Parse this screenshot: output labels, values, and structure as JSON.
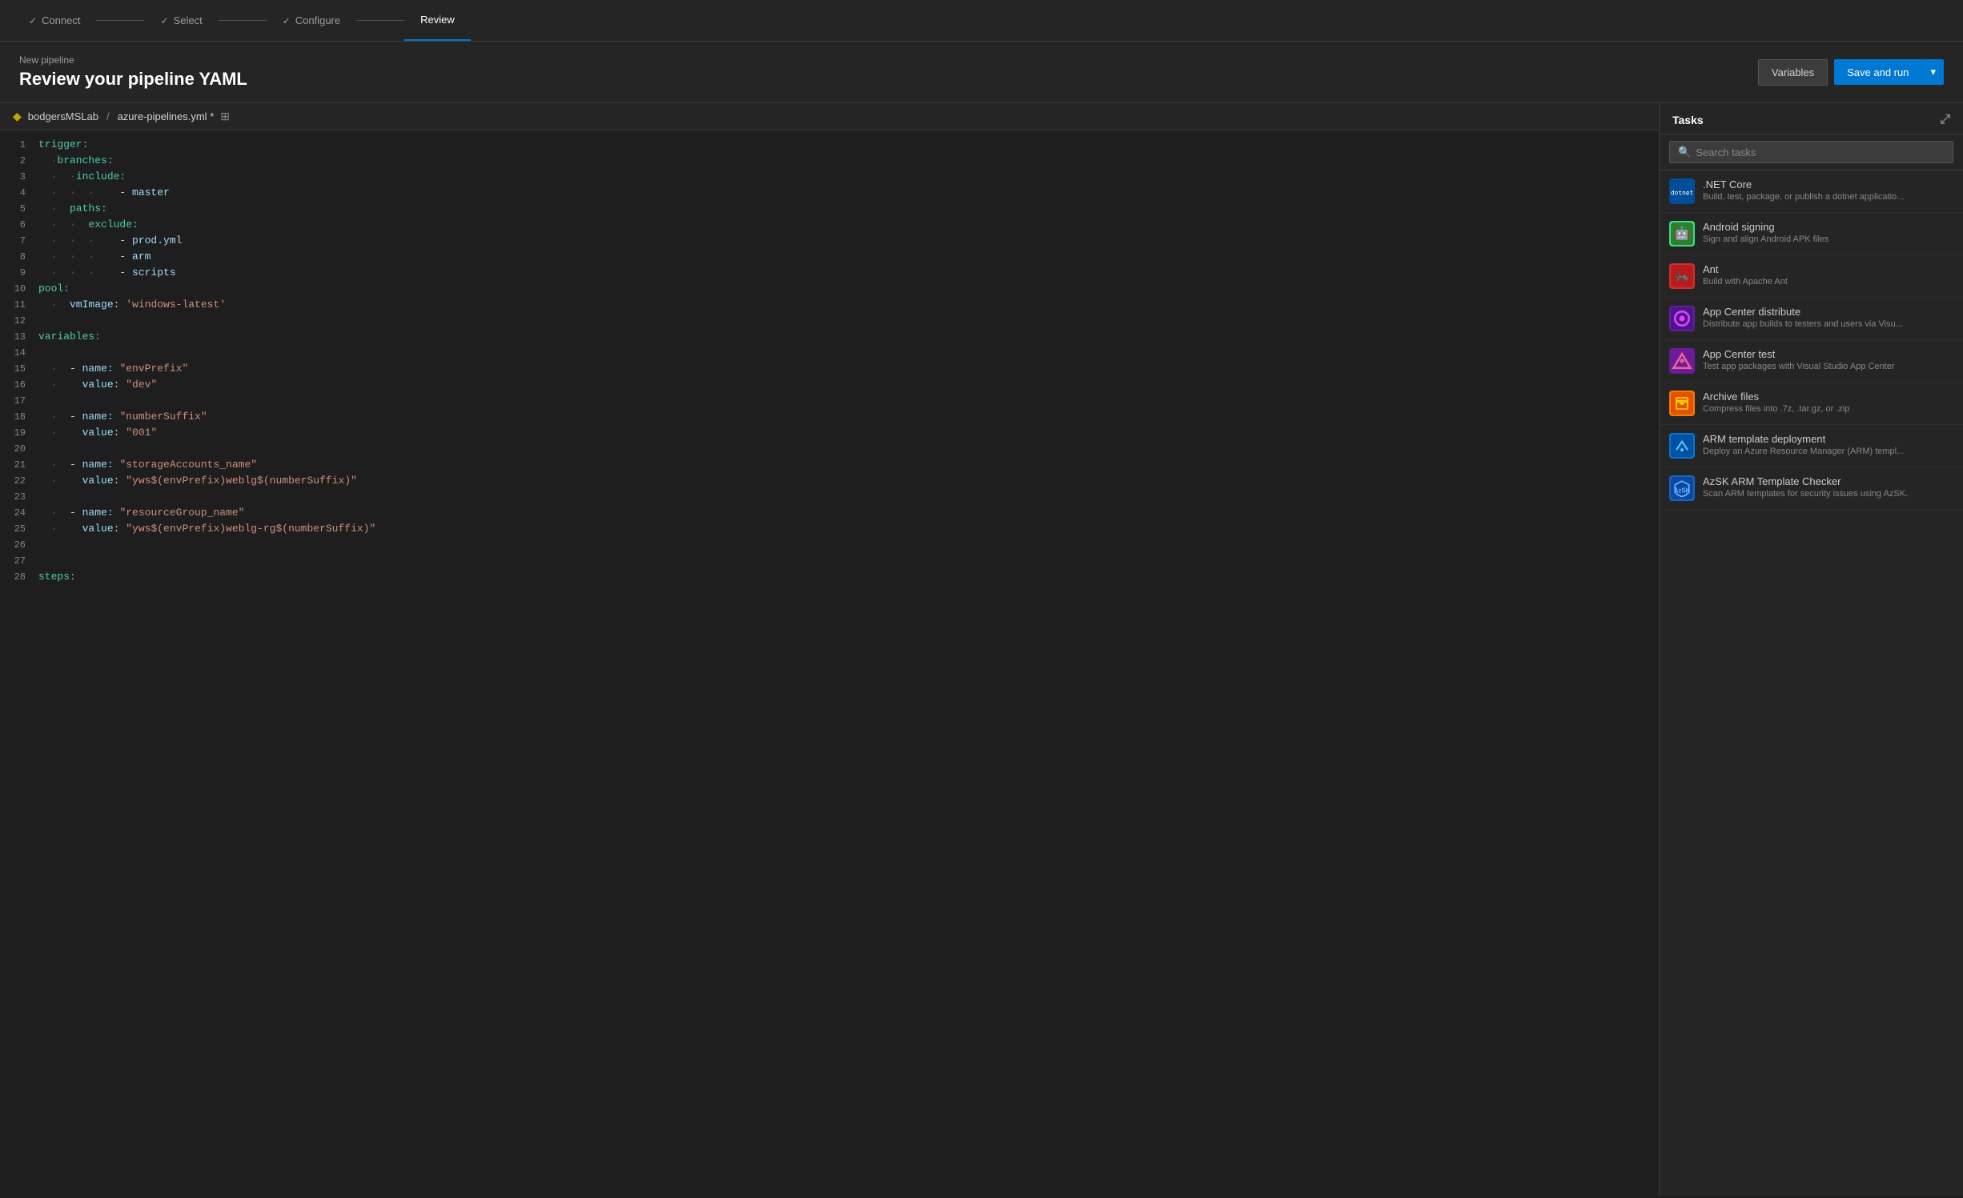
{
  "nav": {
    "steps": [
      {
        "id": "connect",
        "label": "Connect",
        "completed": true
      },
      {
        "id": "select",
        "label": "Select",
        "completed": true
      },
      {
        "id": "configure",
        "label": "Configure",
        "completed": true
      },
      {
        "id": "review",
        "label": "Review",
        "active": true
      }
    ]
  },
  "header": {
    "subtitle": "New pipeline",
    "title": "Review your pipeline YAML",
    "variables_btn": "Variables",
    "save_run_btn": "Save and run"
  },
  "editor": {
    "repo": "bodgersMSLab",
    "separator": "/",
    "filename": "azure-pipelines.yml",
    "modified_marker": "*",
    "lines": [
      {
        "num": 1,
        "content": "trigger:",
        "tokens": [
          {
            "text": "trigger:",
            "class": "kw-green"
          }
        ]
      },
      {
        "num": 2,
        "indent": 1,
        "tokens": [
          {
            "text": "  "
          },
          {
            "text": "branches:",
            "class": "kw-green"
          }
        ]
      },
      {
        "num": 3,
        "indent": 2,
        "tokens": [
          {
            "text": "    "
          },
          {
            "text": "include:",
            "class": "kw-green"
          }
        ]
      },
      {
        "num": 4,
        "indent": 3,
        "tokens": [
          {
            "text": "      "
          },
          {
            "text": "- ",
            "class": "kw-white"
          },
          {
            "text": "master",
            "class": "kw-light"
          }
        ]
      },
      {
        "num": 5,
        "indent": 1,
        "tokens": [
          {
            "text": "  "
          },
          {
            "text": "paths:",
            "class": "kw-green"
          }
        ]
      },
      {
        "num": 6,
        "indent": 2,
        "tokens": [
          {
            "text": "    "
          },
          {
            "text": "exclude:",
            "class": "kw-green"
          }
        ]
      },
      {
        "num": 7,
        "indent": 3,
        "tokens": [
          {
            "text": "      "
          },
          {
            "text": "- ",
            "class": "kw-white"
          },
          {
            "text": "prod.yml",
            "class": "kw-light"
          }
        ]
      },
      {
        "num": 8,
        "indent": 3,
        "tokens": [
          {
            "text": "      "
          },
          {
            "text": "- ",
            "class": "kw-white"
          },
          {
            "text": "arm",
            "class": "kw-light"
          }
        ]
      },
      {
        "num": 9,
        "indent": 3,
        "tokens": [
          {
            "text": "      "
          },
          {
            "text": "- ",
            "class": "kw-white"
          },
          {
            "text": "scripts",
            "class": "kw-light"
          }
        ]
      },
      {
        "num": 10,
        "tokens": [
          {
            "text": "pool:",
            "class": "kw-green"
          }
        ]
      },
      {
        "num": 11,
        "indent": 1,
        "tokens": [
          {
            "text": "  "
          },
          {
            "text": "vmImage: ",
            "class": "kw-light"
          },
          {
            "text": "'windows-latest'",
            "class": "kw-orange"
          }
        ]
      },
      {
        "num": 12,
        "tokens": []
      },
      {
        "num": 13,
        "tokens": [
          {
            "text": "variables:",
            "class": "kw-green"
          }
        ]
      },
      {
        "num": 14,
        "tokens": []
      },
      {
        "num": 15,
        "indent": 1,
        "tokens": [
          {
            "text": "  "
          },
          {
            "text": "- ",
            "class": "kw-white"
          },
          {
            "text": "name: ",
            "class": "kw-light"
          },
          {
            "text": "\"envPrefix\"",
            "class": "kw-orange"
          }
        ]
      },
      {
        "num": 16,
        "indent": 1,
        "tokens": [
          {
            "text": "    "
          },
          {
            "text": "value: ",
            "class": "kw-light"
          },
          {
            "text": "\"dev\"",
            "class": "kw-orange"
          }
        ]
      },
      {
        "num": 17,
        "tokens": []
      },
      {
        "num": 18,
        "indent": 1,
        "tokens": [
          {
            "text": "  "
          },
          {
            "text": "- ",
            "class": "kw-white"
          },
          {
            "text": "name: ",
            "class": "kw-light"
          },
          {
            "text": "\"numberSuffix\"",
            "class": "kw-orange"
          }
        ]
      },
      {
        "num": 19,
        "indent": 1,
        "tokens": [
          {
            "text": "    "
          },
          {
            "text": "value: ",
            "class": "kw-light"
          },
          {
            "text": "\"001\"",
            "class": "kw-orange"
          }
        ]
      },
      {
        "num": 20,
        "tokens": []
      },
      {
        "num": 21,
        "indent": 1,
        "tokens": [
          {
            "text": "  "
          },
          {
            "text": "- ",
            "class": "kw-white"
          },
          {
            "text": "name: ",
            "class": "kw-light"
          },
          {
            "text": "\"storageAccounts_name\"",
            "class": "kw-orange"
          }
        ]
      },
      {
        "num": 22,
        "indent": 1,
        "tokens": [
          {
            "text": "    "
          },
          {
            "text": "value: ",
            "class": "kw-light"
          },
          {
            "text": "\"yws$(envPrefix)weblg$(numberSuffix)\"",
            "class": "kw-orange"
          }
        ]
      },
      {
        "num": 23,
        "tokens": []
      },
      {
        "num": 24,
        "indent": 1,
        "tokens": [
          {
            "text": "  "
          },
          {
            "text": "- ",
            "class": "kw-white"
          },
          {
            "text": "name: ",
            "class": "kw-light"
          },
          {
            "text": "\"resourceGroup_name\"",
            "class": "kw-orange"
          }
        ]
      },
      {
        "num": 25,
        "indent": 1,
        "tokens": [
          {
            "text": "    "
          },
          {
            "text": "value: ",
            "class": "kw-light"
          },
          {
            "text": "\"yws$(envPrefix)weblg-rg$(numberSuffix)\"",
            "class": "kw-orange"
          }
        ]
      },
      {
        "num": 26,
        "tokens": []
      },
      {
        "num": 27,
        "tokens": []
      },
      {
        "num": 28,
        "tokens": [
          {
            "text": "steps:",
            "class": "kw-green"
          }
        ]
      }
    ]
  },
  "tasks": {
    "title": "Tasks",
    "search_placeholder": "Search tasks",
    "items": [
      {
        "id": "dotnet-core",
        "name": ".NET Core",
        "description": "Build, test, package, or publish a dotnet applicatio...",
        "icon_type": "dotnet",
        "icon_text": "dotnet"
      },
      {
        "id": "android-signing",
        "name": "Android signing",
        "description": "Sign and align Android APK files",
        "icon_type": "android",
        "icon_text": "🤖"
      },
      {
        "id": "ant",
        "name": "Ant",
        "description": "Build with Apache Ant",
        "icon_type": "ant",
        "icon_text": "🐜"
      },
      {
        "id": "appcenter-distribute",
        "name": "App Center distribute",
        "description": "Distribute app builds to testers and users via Visu...",
        "icon_type": "appcenter-dist",
        "icon_text": "⬡"
      },
      {
        "id": "appcenter-test",
        "name": "App Center test",
        "description": "Test app packages with Visual Studio App Center",
        "icon_type": "appcenter-test",
        "icon_text": "⬡"
      },
      {
        "id": "archive-files",
        "name": "Archive files",
        "description": "Compress files into .7z, .tar.gz, or .zip",
        "icon_type": "archive",
        "icon_text": "🗜"
      },
      {
        "id": "arm-template",
        "name": "ARM template deployment",
        "description": "Deploy an Azure Resource Manager (ARM) templ...",
        "icon_type": "arm",
        "icon_text": "☁"
      },
      {
        "id": "azsk-arm",
        "name": "AzSK ARM Template Checker",
        "description": "Scan ARM templates for security issues using AzSK.",
        "icon_type": "azsk",
        "icon_text": "🛡"
      }
    ]
  }
}
